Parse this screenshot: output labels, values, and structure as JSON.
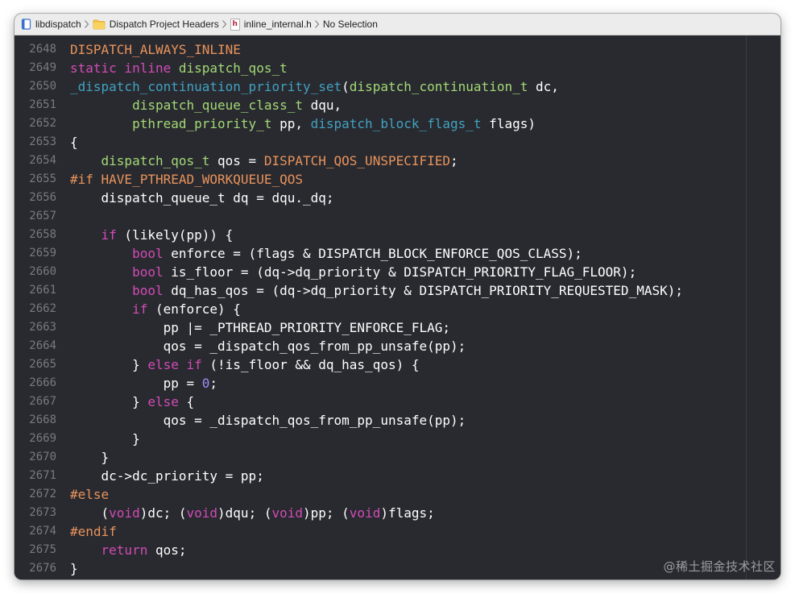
{
  "jumpbar": {
    "items": [
      {
        "label": "libdispatch",
        "icon": "project-icon"
      },
      {
        "label": "Dispatch Project Headers",
        "icon": "folder-icon"
      },
      {
        "label": "inline_internal.h",
        "icon": "header-file-icon",
        "icon_glyph": "h"
      },
      {
        "label": "No Selection",
        "icon": ""
      }
    ]
  },
  "colors": {
    "background": "#292a30",
    "plain": "#ffffff",
    "keyword": "#fc5fa3",
    "type": "#9ef1dd",
    "macro": "#fd8f3f",
    "function": "#67b7a4",
    "number": "#d0bf69",
    "line_number": "#797a80"
  },
  "code_lines": [
    {
      "n": "2648",
      "tokens": [
        [
          "macro",
          "DISPATCH_ALWAYS_INLINE"
        ]
      ]
    },
    {
      "n": "2649",
      "tokens": [
        [
          "kw",
          "static inline "
        ],
        [
          "type2",
          "dispatch_qos_t"
        ]
      ]
    },
    {
      "n": "2650",
      "tokens": [
        [
          "fn",
          "_dispatch_continuation_priority_set"
        ],
        [
          "plain",
          "("
        ],
        [
          "type2",
          "dispatch_continuation_t"
        ],
        [
          "plain",
          " dc,"
        ]
      ]
    },
    {
      "n": "2651",
      "tokens": [
        [
          "plain",
          "        "
        ],
        [
          "type2",
          "dispatch_queue_class_t"
        ],
        [
          "plain",
          " dqu,"
        ]
      ]
    },
    {
      "n": "2652",
      "tokens": [
        [
          "plain",
          "        "
        ],
        [
          "type2",
          "pthread_priority_t"
        ],
        [
          "plain",
          " pp, "
        ],
        [
          "fn",
          "dispatch_block_flags_t"
        ],
        [
          "plain",
          " flags)"
        ]
      ]
    },
    {
      "n": "2653",
      "tokens": [
        [
          "plain",
          "{"
        ]
      ]
    },
    {
      "n": "2654",
      "tokens": [
        [
          "plain",
          "    "
        ],
        [
          "type2",
          "dispatch_qos_t"
        ],
        [
          "plain",
          " qos = "
        ],
        [
          "macro",
          "DISPATCH_QOS_UNSPECIFIED"
        ],
        [
          "plain",
          ";"
        ]
      ]
    },
    {
      "n": "2655",
      "tokens": [
        [
          "macro",
          "#if HAVE_PTHREAD_WORKQUEUE_QOS"
        ]
      ]
    },
    {
      "n": "2656",
      "tokens": [
        [
          "plain",
          "    dispatch_queue_t dq = dqu._dq;"
        ]
      ]
    },
    {
      "n": "2657",
      "tokens": [
        [
          "plain",
          ""
        ]
      ]
    },
    {
      "n": "2658",
      "tokens": [
        [
          "plain",
          "    "
        ],
        [
          "kw",
          "if"
        ],
        [
          "plain",
          " (likely(pp)) {"
        ]
      ]
    },
    {
      "n": "2659",
      "tokens": [
        [
          "plain",
          "        "
        ],
        [
          "kw",
          "bool"
        ],
        [
          "plain",
          " enforce = (flags & DISPATCH_BLOCK_ENFORCE_QOS_CLASS);"
        ]
      ]
    },
    {
      "n": "2660",
      "tokens": [
        [
          "plain",
          "        "
        ],
        [
          "kw",
          "bool"
        ],
        [
          "plain",
          " is_floor = (dq->dq_priority & DISPATCH_PRIORITY_FLAG_FLOOR);"
        ]
      ]
    },
    {
      "n": "2661",
      "tokens": [
        [
          "plain",
          "        "
        ],
        [
          "kw",
          "bool"
        ],
        [
          "plain",
          " dq_has_qos = (dq->dq_priority & DISPATCH_PRIORITY_REQUESTED_MASK);"
        ]
      ]
    },
    {
      "n": "2662",
      "tokens": [
        [
          "plain",
          "        "
        ],
        [
          "kw",
          "if"
        ],
        [
          "plain",
          " (enforce) {"
        ]
      ]
    },
    {
      "n": "2663",
      "tokens": [
        [
          "plain",
          "            pp |= _PTHREAD_PRIORITY_ENFORCE_FLAG;"
        ]
      ]
    },
    {
      "n": "2664",
      "tokens": [
        [
          "plain",
          "            qos = _dispatch_qos_from_pp_unsafe(pp);"
        ]
      ]
    },
    {
      "n": "2665",
      "tokens": [
        [
          "plain",
          "        } "
        ],
        [
          "kw",
          "else if"
        ],
        [
          "plain",
          " (!is_floor && dq_has_qos) {"
        ]
      ]
    },
    {
      "n": "2666",
      "tokens": [
        [
          "plain",
          "            pp = "
        ],
        [
          "num",
          "0"
        ],
        [
          "plain",
          ";"
        ]
      ]
    },
    {
      "n": "2667",
      "tokens": [
        [
          "plain",
          "        } "
        ],
        [
          "kw",
          "else"
        ],
        [
          "plain",
          " {"
        ]
      ]
    },
    {
      "n": "2668",
      "tokens": [
        [
          "plain",
          "            qos = _dispatch_qos_from_pp_unsafe(pp);"
        ]
      ]
    },
    {
      "n": "2669",
      "tokens": [
        [
          "plain",
          "        }"
        ]
      ]
    },
    {
      "n": "2670",
      "tokens": [
        [
          "plain",
          "    }"
        ]
      ]
    },
    {
      "n": "2671",
      "tokens": [
        [
          "plain",
          "    dc->dc_priority = pp;"
        ]
      ]
    },
    {
      "n": "2672",
      "tokens": [
        [
          "macro",
          "#else"
        ]
      ]
    },
    {
      "n": "2673",
      "tokens": [
        [
          "plain",
          "    ("
        ],
        [
          "kw",
          "void"
        ],
        [
          "plain",
          ")dc; ("
        ],
        [
          "kw",
          "void"
        ],
        [
          "plain",
          ")dqu; ("
        ],
        [
          "kw",
          "void"
        ],
        [
          "plain",
          ")pp; ("
        ],
        [
          "kw",
          "void"
        ],
        [
          "plain",
          ")flags;"
        ]
      ]
    },
    {
      "n": "2674",
      "tokens": [
        [
          "macro",
          "#endif"
        ]
      ]
    },
    {
      "n": "2675",
      "tokens": [
        [
          "plain",
          "    "
        ],
        [
          "kw",
          "return"
        ],
        [
          "plain",
          " qos;"
        ]
      ]
    },
    {
      "n": "2676",
      "tokens": [
        [
          "plain",
          "}"
        ]
      ]
    }
  ],
  "watermark": "@稀土掘金技术社区"
}
